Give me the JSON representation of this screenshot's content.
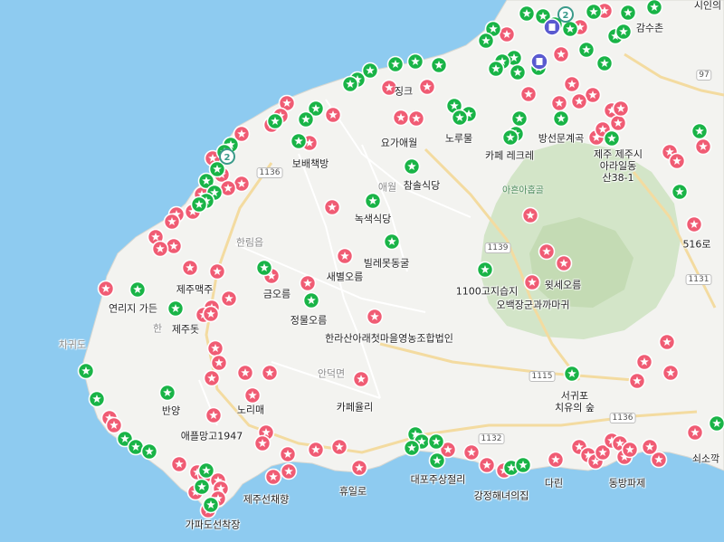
{
  "map": {
    "colors": {
      "sea": "#8ecbf0",
      "land": "#f3f3f0",
      "mountain": "#d3e5c8",
      "mountain_dark": "#c4dbb4",
      "road": "#ffffff",
      "road_main": "#f6d88e",
      "red_marker": "#f05c74",
      "green_marker": "#19b447",
      "cluster": "#3a9a8a",
      "poi_blue": "#5a5ad0"
    },
    "place_labels": [
      "시인의",
      "감수촌",
      "징크",
      "요가애월",
      "노루물",
      "방선문계곡",
      "보배책방",
      "카페 레크레",
      "제주 제주시 아라일동 산38-1",
      "참솔식당",
      "녹색식당",
      "빌레못동굴",
      "새별오름",
      "1100고지습지",
      "윗세오름",
      "오백장군과까마귀",
      "제주맥주",
      "금오름",
      "연리지 가든",
      "제주돗",
      "정물오름",
      "한라산아래첫마을영농조합법인",
      "516로",
      "노리매",
      "카페율리",
      "서귀포 치유의 숲",
      "반양",
      "애플망고1947",
      "쇠소깍",
      "대포주상절리",
      "제주선채향",
      "휴일로",
      "강정해녀의집",
      "다린",
      "동방파제",
      "가파도선착장"
    ],
    "town_labels": [
      "한림읍",
      "애월",
      "안덕면",
      "차귀도",
      "한"
    ],
    "road_numbers": [
      "97",
      "1136",
      "1139",
      "1131",
      "1115",
      "1136",
      "1132"
    ],
    "park_label": "아흔아홉골",
    "clusters": [
      "2",
      "2"
    ]
  }
}
